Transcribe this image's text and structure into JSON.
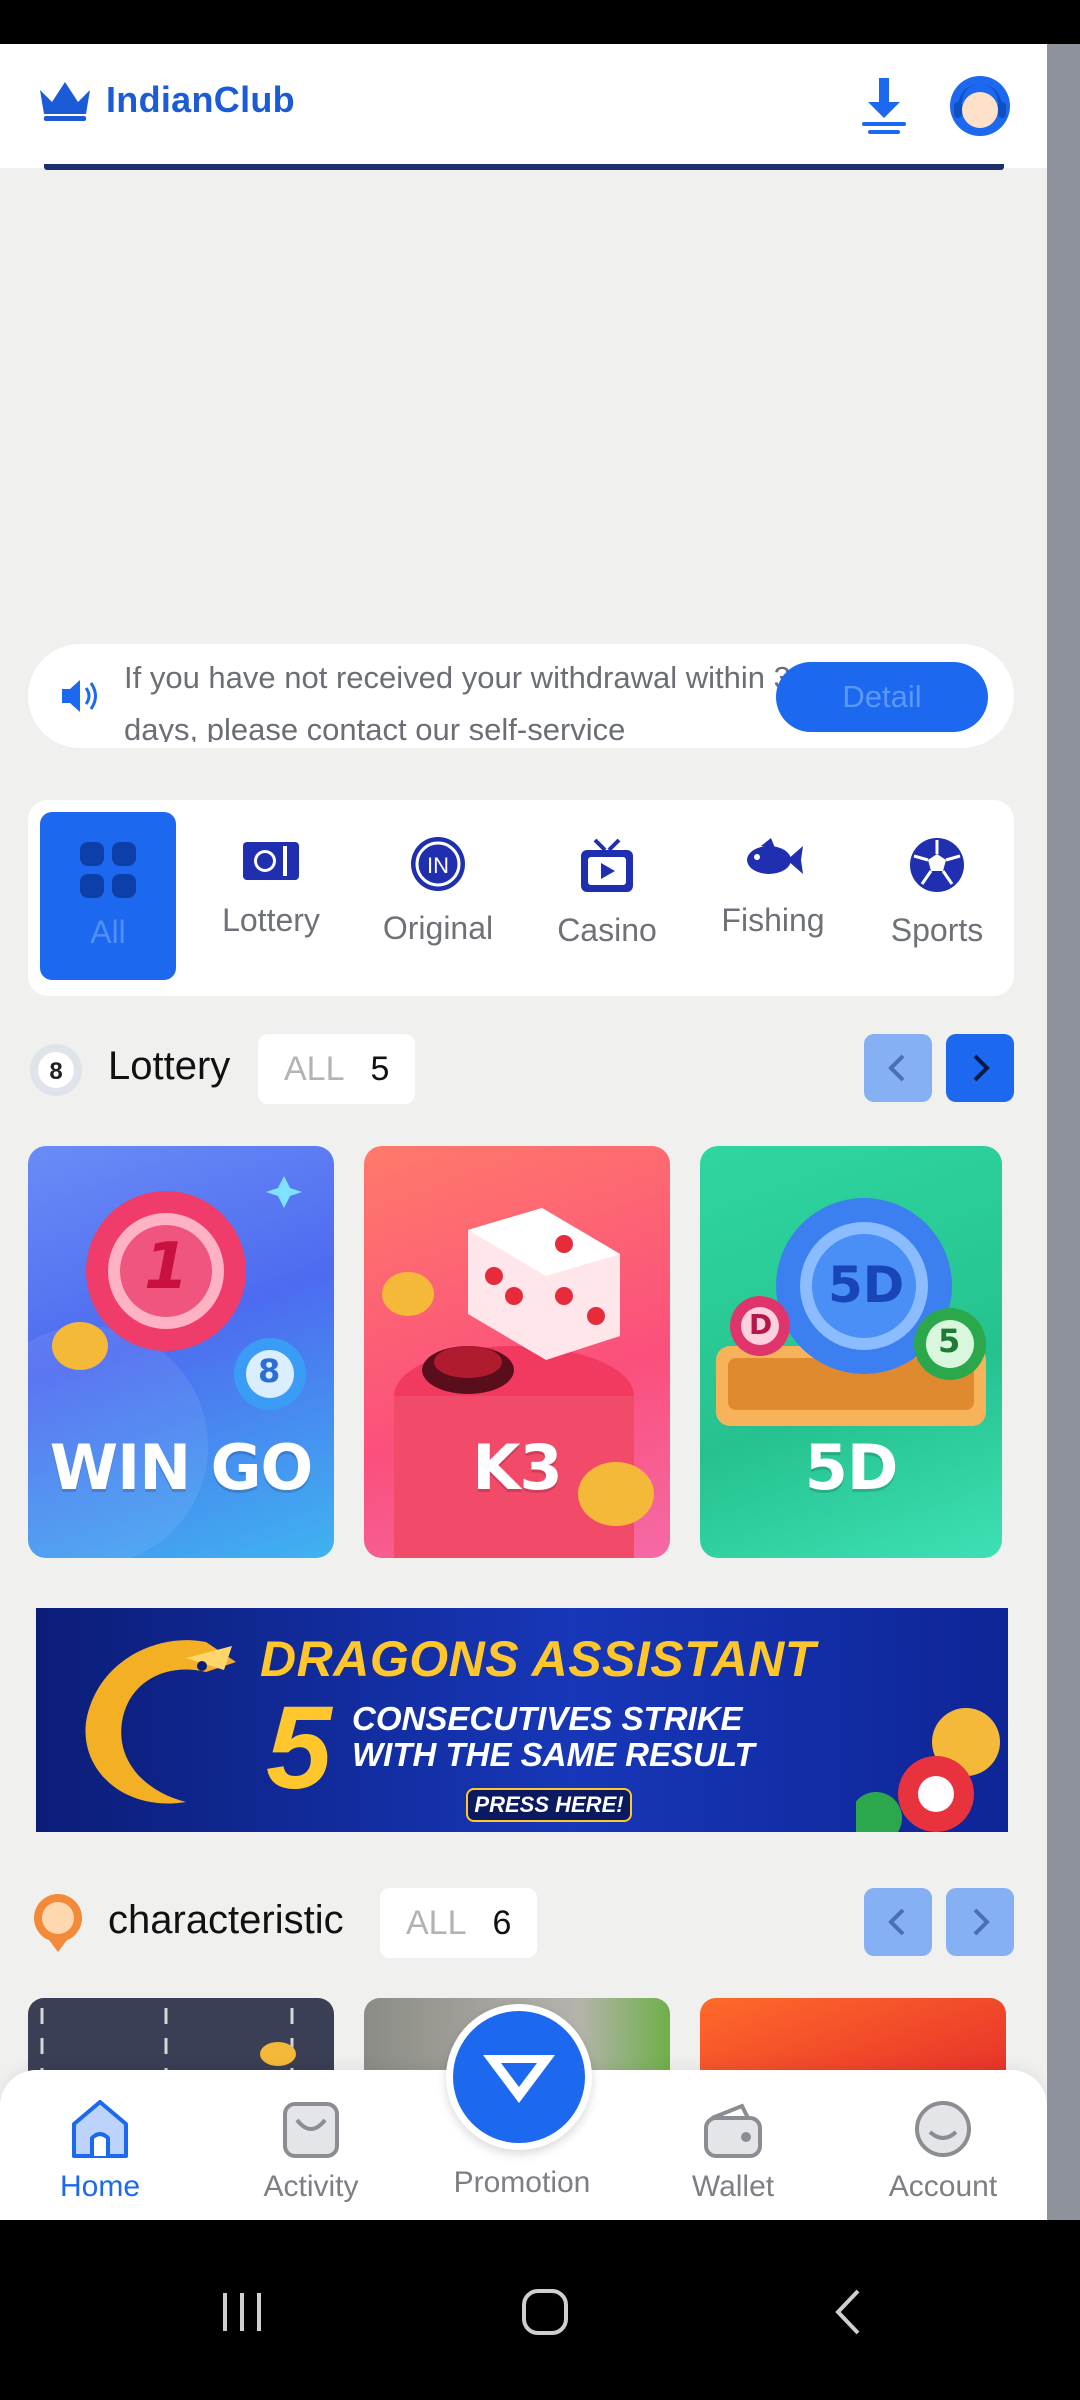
{
  "header": {
    "brand": "IndianClub"
  },
  "notice": {
    "text": "If you have not received your withdrawal within 3 days, please contact our self-service",
    "detail_label": "Detail"
  },
  "categories": [
    {
      "label": "All",
      "icon": "grid-icon",
      "active": true
    },
    {
      "label": "Lottery",
      "icon": "lottery-icon"
    },
    {
      "label": "Original",
      "icon": "original-icon"
    },
    {
      "label": "Casino",
      "icon": "casino-tv-icon"
    },
    {
      "label": "Fishing",
      "icon": "fish-icon"
    },
    {
      "label": "Sports",
      "icon": "soccer-ball-icon"
    }
  ],
  "lottery_section": {
    "title": "Lottery",
    "all_label": "ALL",
    "count": "5",
    "games": [
      {
        "name": "WIN GO",
        "ball_number": "1",
        "small_ball": "8"
      },
      {
        "name": "K3"
      },
      {
        "name": "5D",
        "ball_text": "5D",
        "small_ball": "5",
        "small_ball_2": "D"
      }
    ]
  },
  "promo_banner": {
    "title": "DRAGONS ASSISTANT",
    "number": "5",
    "line1": "CONSECUTIVES STRIKE",
    "line2": "WITH THE SAME RESULT",
    "button": "PRESS HERE!"
  },
  "characteristic_section": {
    "title": "characteristic",
    "all_label": "ALL",
    "count": "6"
  },
  "tabbar": {
    "tabs": [
      {
        "label": "Home",
        "icon": "home-icon",
        "active": true
      },
      {
        "label": "Activity",
        "icon": "activity-bag-icon"
      },
      {
        "label": "Promotion",
        "icon": "diamond-icon"
      },
      {
        "label": "Wallet",
        "icon": "wallet-icon"
      },
      {
        "label": "Account",
        "icon": "account-icon"
      }
    ]
  },
  "colors": {
    "accent": "#1c69f0",
    "brand": "#1b5bd6",
    "background": "#f0f0ee"
  }
}
